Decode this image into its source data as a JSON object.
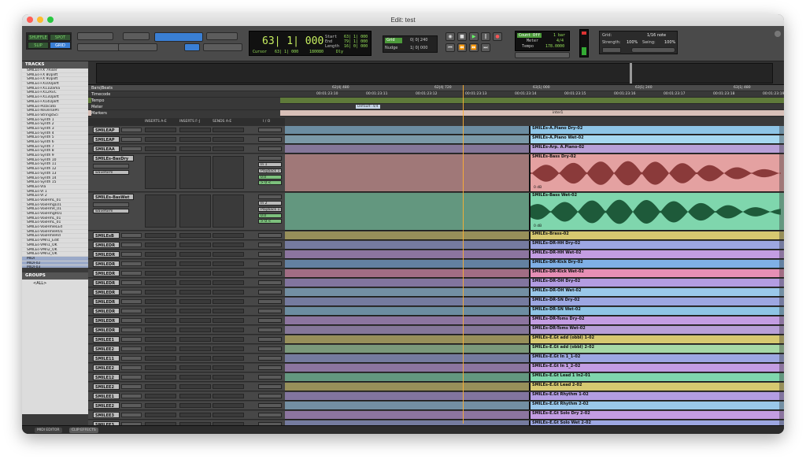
{
  "window": {
    "title": "Edit: test"
  },
  "toolbar": {
    "modes": [
      "SHUFFLE",
      "SPOT",
      "SLIP",
      "GRID"
    ],
    "counter": {
      "main": "63| 1| 000",
      "cursor_label": "Cursor",
      "cursor_value": "63| 1| 000",
      "extra_value": "180080",
      "start_label": "Start",
      "start": "63| 1| 000",
      "end_label": "End",
      "end": "79| 1| 000",
      "length_label": "Length",
      "length": "16| 0| 000",
      "dly_label": "Dly"
    },
    "grid_label": "Grid",
    "grid_value": "0| 0| 240",
    "nudge_label": "Nudge",
    "nudge_value": "1| 0| 000",
    "tempo_box": {
      "count_off": "Count Off",
      "count_off_value": "1 bar",
      "meter_label": "Meter",
      "meter": "4/4",
      "tempo_label": "Tempo",
      "tempo": "178.0000"
    },
    "grid_panel": {
      "grid_label": "Grid:",
      "grid_value": "1/16 note",
      "strength_label": "Strength:",
      "strength_value": "100%",
      "swing_label": "Swing:",
      "swing_value": "100%"
    }
  },
  "tracks_panel": {
    "title": "TRACKS",
    "items": [
      "SMILEs-FX 7Riser",
      "SMILEs-FX 8Uplift",
      "SMILEs-FX 9Uplift",
      "SMILEs-FX10Uplift",
      "SMILEs-FX11Dama",
      "SMILEs-FX12RvC",
      "SMILEs-FX13Uplift",
      "SMILEs-FX14Uplift",
      "SMILEs-Pizzicato",
      "SMILEs-ReversePn",
      "SMILEs-StringsSci",
      "SMILEs-Synth 1",
      "SMILEs-Synth 2",
      "SMILEs-Synth 3",
      "SMILEs-Synth 4",
      "SMILEs-Synth 5",
      "SMILEs-Synth 6",
      "SMILEs-Synth 7",
      "SMILEs-Synth 8",
      "SMILEs-Synth 9",
      "SMILEs-Synth 10",
      "SMILEs-Synth 11",
      "SMILEs-Synth 12",
      "SMILEs-Synth 13",
      "SMILEs-Synth 14",
      "SMILEs-Synth 15",
      "SMILEs-Vla",
      "SMILEs-Vl 1",
      "SMILEs-Vl 2",
      "SMILEs-VoxHmL_01",
      "SMILEs-VoxHmgL01",
      "SMILEs-VoxHmR_01",
      "SMILEs-VoxHmgR01",
      "SMILEs-VoxHmL_01",
      "SMILEs-VoxHmL_01",
      "SMILEs-VoxHmleLEd",
      "SMILEs-VoxHmleR01",
      "SMILEs-VoxHmleRd",
      "SMILEs-VMn1_Edit",
      "SMILEs-VMn1_OK",
      "SMILEs-VMn2_OK",
      "SMILEs-VMn3_OK",
      "MIDI",
      "MIDI-02",
      "MIDI-03"
    ],
    "selected": [
      42,
      43,
      44
    ]
  },
  "groups_panel": {
    "title": "GROUPS",
    "item": "<ALL>"
  },
  "rulers": {
    "bars_beats": "Bars|Beats",
    "timecode": "Timecode",
    "tempo": "Tempo",
    "meter": "Meter",
    "markers": "Markers",
    "bar_ticks": [
      "62|4| 480",
      "62|4| 720",
      "63|1| 000",
      "63|1| 240",
      "63|1| 480"
    ],
    "tc_ticks": [
      "00:01:23:10",
      "00:01:23:11",
      "00:01:23:12",
      "00:01:23:13",
      "00:01:23:14",
      "00:01:23:15",
      "00:01:23:16",
      "00:01:23:17",
      "00:01:23:18",
      "00:01:23:19"
    ],
    "meter_value": "Default: 4/4",
    "marker_name": "inter1"
  },
  "mixer_header": {
    "inserts_ae": "INSERTS A-E",
    "inserts_fj": "INSERTS F-J",
    "sends_ae": "SENDS A-E",
    "io": "I / O"
  },
  "tracks": [
    {
      "name": "SMILEAP",
      "clip": "SMILEs-A.Piano Dry-02",
      "color": "#8ec5e6",
      "h": 11
    },
    {
      "name": "SMILEAP",
      "clip": "SMILEs-A.Piano Wet-02",
      "color": "#a6d8f0",
      "h": 11
    },
    {
      "name": "SMILEAA",
      "clip": "SMILEs-Arp. A.Piano-02",
      "color": "#b8a0d8",
      "h": 11
    },
    {
      "name": "SMILEs-BasDry",
      "clip": "SMILEs-Bass Dry-02",
      "color": "#e4a1a1",
      "h": 48,
      "big": true,
      "io_in": "In 1",
      "io_out": "Playback 1-2",
      "view": "waveform",
      "vol": "0.0",
      "pan": "> 0 <",
      "gain": "0 dB"
    },
    {
      "name": "SMILEs-BasWet",
      "clip": "SMILEs-Bass Wet-02",
      "color": "#7fd6ad",
      "h": 48,
      "big": true,
      "io_in": "In 2",
      "io_out": "Playback 1-2",
      "view": "waveform",
      "vol": "0.0",
      "pan": "> 0 <",
      "gain": "0 dB"
    },
    {
      "name": "SMILEsB",
      "clip": "SMILEs-Brass-02",
      "color": "#d6c870",
      "h": 11
    },
    {
      "name": "SMILEDR",
      "clip": "SMILEs-DR-HH Dry-02",
      "color": "#9da7e2",
      "h": 11
    },
    {
      "name": "SMILEDR",
      "clip": "SMILEs-DR-HH Wet-02",
      "color": "#c39de2",
      "h": 11
    },
    {
      "name": "SMILEDR",
      "clip": "SMILEs-DR-Kick Dry-02",
      "color": "#7fb0e6",
      "h": 11
    },
    {
      "name": "SMILEDR",
      "clip": "SMILEs-DR-Kick Wet-02",
      "color": "#e68fb5",
      "h": 11
    },
    {
      "name": "SMILEDR",
      "clip": "SMILEs-DR-OH Dry-02",
      "color": "#b39de2",
      "h": 11
    },
    {
      "name": "SMILEDR",
      "clip": "SMILEs-DR-OH Wet-02",
      "color": "#9ac8ea",
      "h": 11
    },
    {
      "name": "SMILEDR",
      "clip": "SMILEs-DR-SN Dry-02",
      "color": "#9da7e2",
      "h": 11
    },
    {
      "name": "SMILEDR",
      "clip": "SMILEs-DR-SN Wet-02",
      "color": "#8ec5e6",
      "h": 11
    },
    {
      "name": "SMILEDR",
      "clip": "SMILEs-DR-Toms Dry-02",
      "color": "#c39de2",
      "h": 11
    },
    {
      "name": "SMILEDR",
      "clip": "SMILEs-DR-Toms Wet-02",
      "color": "#b8a0d8",
      "h": 11
    },
    {
      "name": "SMILEE1",
      "clip": "SMILEs-E.Gt add (obbl) 1-02",
      "color": "#d6c870",
      "h": 11
    },
    {
      "name": "SMILEE2",
      "clip": "SMILEs-E.Gt add (obbl) 2-02",
      "color": "#a6d8a6",
      "h": 11
    },
    {
      "name": "SMILE11",
      "clip": "SMILEs-E.Gt In 1_1-02",
      "color": "#9da7e2",
      "h": 11
    },
    {
      "name": "SMILEE2",
      "clip": "SMILEs-E.Gt In 1_2-02",
      "color": "#c39de2",
      "h": 11
    },
    {
      "name": "SMILE12",
      "clip": "SMILEs-E.Gt Lead 1 In2-01",
      "color": "#7fd6ad",
      "h": 11
    },
    {
      "name": "SMILEE2",
      "clip": "SMILEs-E.Gt Lead 2-02",
      "color": "#d6c870",
      "h": 11
    },
    {
      "name": "SMILEE1",
      "clip": "SMILEs-E.Gt Rhythm 1-02",
      "color": "#b39de2",
      "h": 11
    },
    {
      "name": "SMILEE2",
      "clip": "SMILEs-E.Gt Rhythm 2-02",
      "color": "#9ac8ea",
      "h": 11
    },
    {
      "name": "SMILEE3",
      "clip": "SMILEs-E.Gt Solo Dry 2-02",
      "color": "#c39de2",
      "h": 11
    },
    {
      "name": "SMILEE3",
      "clip": "SMILEs-E.Gt Solo Wet 2-02",
      "color": "#9da7e2",
      "h": 11
    }
  ],
  "bottom_tabs": [
    "MIDI EDITOR",
    "CLIP EFFECTS"
  ]
}
